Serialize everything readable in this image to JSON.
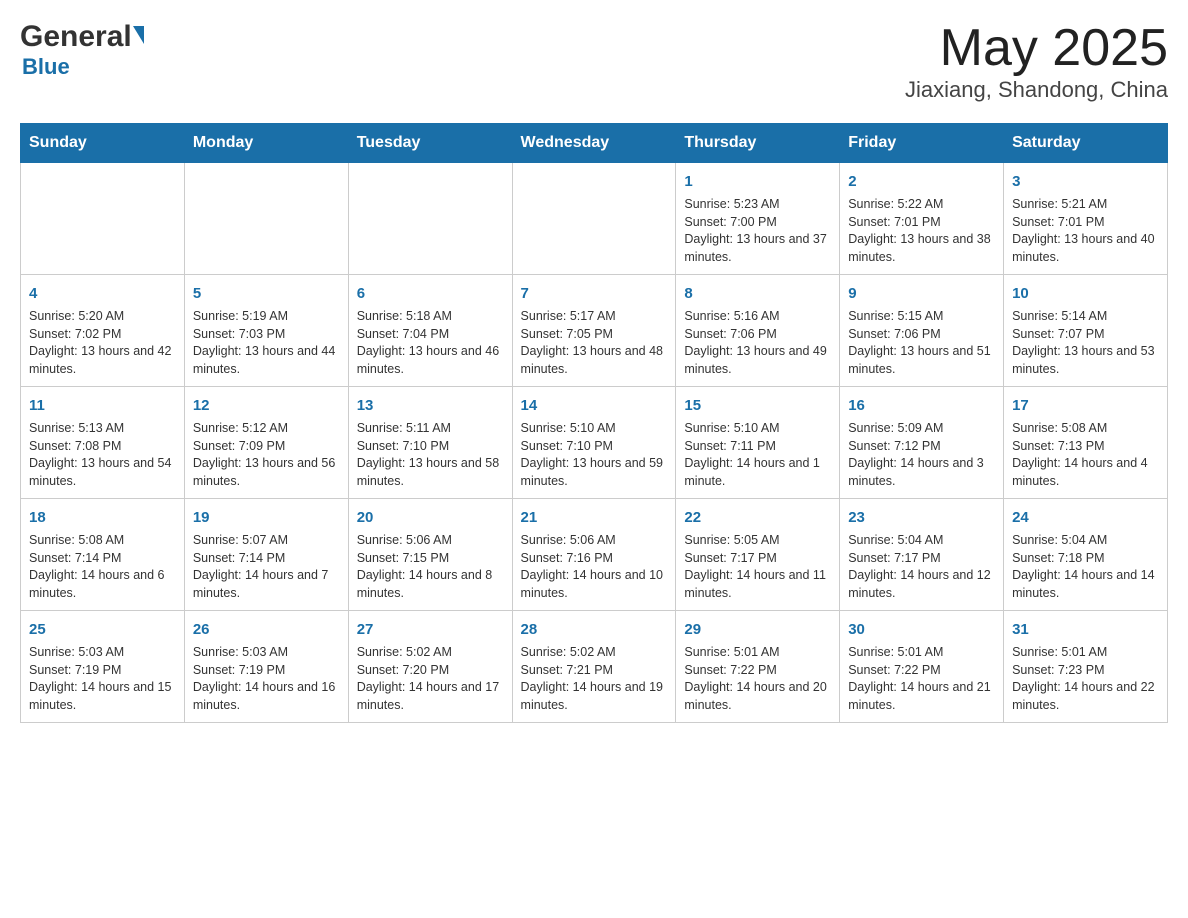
{
  "header": {
    "logo_general": "General",
    "logo_blue": "Blue",
    "title": "May 2025",
    "subtitle": "Jiaxiang, Shandong, China"
  },
  "weekdays": [
    "Sunday",
    "Monday",
    "Tuesday",
    "Wednesday",
    "Thursday",
    "Friday",
    "Saturday"
  ],
  "weeks": [
    [
      {
        "day": "",
        "info": ""
      },
      {
        "day": "",
        "info": ""
      },
      {
        "day": "",
        "info": ""
      },
      {
        "day": "",
        "info": ""
      },
      {
        "day": "1",
        "info": "Sunrise: 5:23 AM\nSunset: 7:00 PM\nDaylight: 13 hours and 37 minutes."
      },
      {
        "day": "2",
        "info": "Sunrise: 5:22 AM\nSunset: 7:01 PM\nDaylight: 13 hours and 38 minutes."
      },
      {
        "day": "3",
        "info": "Sunrise: 5:21 AM\nSunset: 7:01 PM\nDaylight: 13 hours and 40 minutes."
      }
    ],
    [
      {
        "day": "4",
        "info": "Sunrise: 5:20 AM\nSunset: 7:02 PM\nDaylight: 13 hours and 42 minutes."
      },
      {
        "day": "5",
        "info": "Sunrise: 5:19 AM\nSunset: 7:03 PM\nDaylight: 13 hours and 44 minutes."
      },
      {
        "day": "6",
        "info": "Sunrise: 5:18 AM\nSunset: 7:04 PM\nDaylight: 13 hours and 46 minutes."
      },
      {
        "day": "7",
        "info": "Sunrise: 5:17 AM\nSunset: 7:05 PM\nDaylight: 13 hours and 48 minutes."
      },
      {
        "day": "8",
        "info": "Sunrise: 5:16 AM\nSunset: 7:06 PM\nDaylight: 13 hours and 49 minutes."
      },
      {
        "day": "9",
        "info": "Sunrise: 5:15 AM\nSunset: 7:06 PM\nDaylight: 13 hours and 51 minutes."
      },
      {
        "day": "10",
        "info": "Sunrise: 5:14 AM\nSunset: 7:07 PM\nDaylight: 13 hours and 53 minutes."
      }
    ],
    [
      {
        "day": "11",
        "info": "Sunrise: 5:13 AM\nSunset: 7:08 PM\nDaylight: 13 hours and 54 minutes."
      },
      {
        "day": "12",
        "info": "Sunrise: 5:12 AM\nSunset: 7:09 PM\nDaylight: 13 hours and 56 minutes."
      },
      {
        "day": "13",
        "info": "Sunrise: 5:11 AM\nSunset: 7:10 PM\nDaylight: 13 hours and 58 minutes."
      },
      {
        "day": "14",
        "info": "Sunrise: 5:10 AM\nSunset: 7:10 PM\nDaylight: 13 hours and 59 minutes."
      },
      {
        "day": "15",
        "info": "Sunrise: 5:10 AM\nSunset: 7:11 PM\nDaylight: 14 hours and 1 minute."
      },
      {
        "day": "16",
        "info": "Sunrise: 5:09 AM\nSunset: 7:12 PM\nDaylight: 14 hours and 3 minutes."
      },
      {
        "day": "17",
        "info": "Sunrise: 5:08 AM\nSunset: 7:13 PM\nDaylight: 14 hours and 4 minutes."
      }
    ],
    [
      {
        "day": "18",
        "info": "Sunrise: 5:08 AM\nSunset: 7:14 PM\nDaylight: 14 hours and 6 minutes."
      },
      {
        "day": "19",
        "info": "Sunrise: 5:07 AM\nSunset: 7:14 PM\nDaylight: 14 hours and 7 minutes."
      },
      {
        "day": "20",
        "info": "Sunrise: 5:06 AM\nSunset: 7:15 PM\nDaylight: 14 hours and 8 minutes."
      },
      {
        "day": "21",
        "info": "Sunrise: 5:06 AM\nSunset: 7:16 PM\nDaylight: 14 hours and 10 minutes."
      },
      {
        "day": "22",
        "info": "Sunrise: 5:05 AM\nSunset: 7:17 PM\nDaylight: 14 hours and 11 minutes."
      },
      {
        "day": "23",
        "info": "Sunrise: 5:04 AM\nSunset: 7:17 PM\nDaylight: 14 hours and 12 minutes."
      },
      {
        "day": "24",
        "info": "Sunrise: 5:04 AM\nSunset: 7:18 PM\nDaylight: 14 hours and 14 minutes."
      }
    ],
    [
      {
        "day": "25",
        "info": "Sunrise: 5:03 AM\nSunset: 7:19 PM\nDaylight: 14 hours and 15 minutes."
      },
      {
        "day": "26",
        "info": "Sunrise: 5:03 AM\nSunset: 7:19 PM\nDaylight: 14 hours and 16 minutes."
      },
      {
        "day": "27",
        "info": "Sunrise: 5:02 AM\nSunset: 7:20 PM\nDaylight: 14 hours and 17 minutes."
      },
      {
        "day": "28",
        "info": "Sunrise: 5:02 AM\nSunset: 7:21 PM\nDaylight: 14 hours and 19 minutes."
      },
      {
        "day": "29",
        "info": "Sunrise: 5:01 AM\nSunset: 7:22 PM\nDaylight: 14 hours and 20 minutes."
      },
      {
        "day": "30",
        "info": "Sunrise: 5:01 AM\nSunset: 7:22 PM\nDaylight: 14 hours and 21 minutes."
      },
      {
        "day": "31",
        "info": "Sunrise: 5:01 AM\nSunset: 7:23 PM\nDaylight: 14 hours and 22 minutes."
      }
    ]
  ]
}
